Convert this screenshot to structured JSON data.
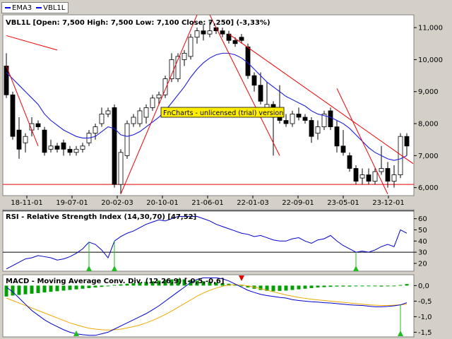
{
  "legend": [
    {
      "label": "EMA3",
      "color": "#0000ff"
    },
    {
      "label": "VBL1L",
      "color": "#0000ff"
    }
  ],
  "watermark": "FnCharts - unlicensed (trial) version",
  "colors": {
    "ema": "#1c1cdc",
    "trendline": "#ee0000",
    "rsi": "#0000cc",
    "macd": "#0000cc",
    "signal": "#f0a800",
    "hist": "#00a000",
    "arrow_up": "#22bb22",
    "arrow_down": "#dd0000",
    "watermark_bg": "#ffee00"
  },
  "chart_data": [
    {
      "type": "candlestick",
      "title": "VBL1L [Open: 7,500  High: 7,500  Low: 7,100  Close: 7,250] (-3,33%)",
      "ylim": [
        5.75,
        11.4
      ],
      "yticks": [
        6.0,
        7.0,
        8.0,
        9.0,
        10.0,
        11.0
      ],
      "ytick_labels": [
        "6,000",
        "7,000",
        "8,000",
        "9,000",
        "10,000",
        "11,000"
      ],
      "xtick_labels": [
        "18-11-01",
        "19-07-01",
        "20-02-03",
        "20-10-01",
        "21-06-01",
        "22-01-03",
        "22-09-01",
        "23-05-01",
        "23-12-01"
      ],
      "support_level": 6.1,
      "candles": [
        {
          "o": 9.8,
          "h": 10.2,
          "l": 8.8,
          "c": 8.9
        },
        {
          "o": 8.9,
          "h": 9.0,
          "l": 7.5,
          "c": 7.6
        },
        {
          "o": 7.8,
          "h": 8.2,
          "l": 6.9,
          "c": 7.2
        },
        {
          "o": 7.4,
          "h": 7.7,
          "l": 7.1,
          "c": 7.6
        },
        {
          "o": 7.8,
          "h": 8.2,
          "l": 7.6,
          "c": 8.0
        },
        {
          "o": 8.0,
          "h": 8.1,
          "l": 7.8,
          "c": 7.9
        },
        {
          "o": 7.8,
          "h": 7.9,
          "l": 7.0,
          "c": 7.1
        },
        {
          "o": 7.2,
          "h": 7.5,
          "l": 7.1,
          "c": 7.3
        },
        {
          "o": 7.3,
          "h": 7.4,
          "l": 7.1,
          "c": 7.2
        },
        {
          "o": 7.4,
          "h": 7.5,
          "l": 7.0,
          "c": 7.2
        },
        {
          "o": 7.2,
          "h": 7.3,
          "l": 7.0,
          "c": 7.1
        },
        {
          "o": 7.1,
          "h": 7.3,
          "l": 7.0,
          "c": 7.2
        },
        {
          "o": 7.2,
          "h": 7.4,
          "l": 7.1,
          "c": 7.3
        },
        {
          "o": 7.4,
          "h": 7.8,
          "l": 7.3,
          "c": 7.7
        },
        {
          "o": 7.7,
          "h": 8.0,
          "l": 7.5,
          "c": 7.9
        },
        {
          "o": 8.0,
          "h": 8.5,
          "l": 7.9,
          "c": 8.3
        },
        {
          "o": 8.3,
          "h": 8.5,
          "l": 8.2,
          "c": 8.4
        },
        {
          "o": 8.5,
          "h": 8.6,
          "l": 6.0,
          "c": 6.1
        },
        {
          "o": 6.1,
          "h": 7.2,
          "l": 5.8,
          "c": 7.1
        },
        {
          "o": 7.0,
          "h": 8.1,
          "l": 6.9,
          "c": 8.0
        },
        {
          "o": 8.0,
          "h": 8.3,
          "l": 7.9,
          "c": 8.2
        },
        {
          "o": 8.0,
          "h": 8.5,
          "l": 7.9,
          "c": 8.4
        },
        {
          "o": 8.2,
          "h": 8.6,
          "l": 8.0,
          "c": 8.5
        },
        {
          "o": 8.5,
          "h": 8.9,
          "l": 8.4,
          "c": 8.8
        },
        {
          "o": 8.8,
          "h": 9.0,
          "l": 8.6,
          "c": 8.9
        },
        {
          "o": 8.9,
          "h": 9.5,
          "l": 8.8,
          "c": 9.4
        },
        {
          "o": 9.4,
          "h": 10.2,
          "l": 9.3,
          "c": 10.0
        },
        {
          "o": 9.4,
          "h": 10.2,
          "l": 9.3,
          "c": 10.1
        },
        {
          "o": 10.0,
          "h": 10.3,
          "l": 9.8,
          "c": 10.2
        },
        {
          "o": 10.1,
          "h": 10.8,
          "l": 10.0,
          "c": 10.7
        },
        {
          "o": 10.7,
          "h": 11.0,
          "l": 10.5,
          "c": 10.9
        },
        {
          "o": 10.9,
          "h": 11.1,
          "l": 10.6,
          "c": 10.8
        },
        {
          "o": 10.8,
          "h": 11.2,
          "l": 10.7,
          "c": 10.9
        },
        {
          "o": 11.0,
          "h": 11.0,
          "l": 10.8,
          "c": 10.9
        },
        {
          "o": 10.9,
          "h": 11.0,
          "l": 10.7,
          "c": 10.8
        },
        {
          "o": 10.8,
          "h": 10.9,
          "l": 10.5,
          "c": 10.6
        },
        {
          "o": 10.6,
          "h": 10.7,
          "l": 10.4,
          "c": 10.5
        },
        {
          "o": 10.7,
          "h": 10.8,
          "l": 10.5,
          "c": 10.6
        },
        {
          "o": 10.4,
          "h": 10.5,
          "l": 9.4,
          "c": 9.5
        },
        {
          "o": 9.5,
          "h": 9.6,
          "l": 9.0,
          "c": 9.2
        },
        {
          "o": 9.2,
          "h": 9.6,
          "l": 8.6,
          "c": 8.7
        },
        {
          "o": 8.5,
          "h": 9.3,
          "l": 8.3,
          "c": 8.6
        },
        {
          "o": 8.6,
          "h": 8.7,
          "l": 7.0,
          "c": 8.2
        },
        {
          "o": 8.3,
          "h": 9.2,
          "l": 8.0,
          "c": 8.1
        },
        {
          "o": 8.1,
          "h": 8.3,
          "l": 7.9,
          "c": 8.0
        },
        {
          "o": 8.0,
          "h": 8.4,
          "l": 7.9,
          "c": 8.3
        },
        {
          "o": 8.3,
          "h": 8.5,
          "l": 8.1,
          "c": 8.2
        },
        {
          "o": 8.2,
          "h": 8.3,
          "l": 8.0,
          "c": 8.1
        },
        {
          "o": 8.1,
          "h": 8.2,
          "l": 7.4,
          "c": 7.6
        },
        {
          "o": 7.7,
          "h": 8.1,
          "l": 7.5,
          "c": 7.9
        },
        {
          "o": 7.9,
          "h": 8.4,
          "l": 7.8,
          "c": 8.3
        },
        {
          "o": 8.4,
          "h": 8.5,
          "l": 7.8,
          "c": 7.9
        },
        {
          "o": 7.9,
          "h": 8.1,
          "l": 7.1,
          "c": 7.3
        },
        {
          "o": 7.3,
          "h": 7.8,
          "l": 7.0,
          "c": 7.1
        },
        {
          "o": 7.0,
          "h": 7.1,
          "l": 6.5,
          "c": 6.6
        },
        {
          "o": 6.6,
          "h": 6.7,
          "l": 6.1,
          "c": 6.2
        },
        {
          "o": 6.3,
          "h": 6.6,
          "l": 6.1,
          "c": 6.4
        },
        {
          "o": 6.4,
          "h": 6.6,
          "l": 6.1,
          "c": 6.2
        },
        {
          "o": 6.2,
          "h": 6.6,
          "l": 6.1,
          "c": 6.5
        },
        {
          "o": 6.5,
          "h": 7.3,
          "l": 6.4,
          "c": 6.6
        },
        {
          "o": 6.6,
          "h": 6.8,
          "l": 6.0,
          "c": 6.2
        },
        {
          "o": 6.2,
          "h": 6.7,
          "l": 6.0,
          "c": 6.4
        },
        {
          "o": 6.4,
          "h": 7.7,
          "l": 6.3,
          "c": 7.6
        },
        {
          "o": 7.6,
          "h": 7.7,
          "l": 7.0,
          "c": 7.3
        }
      ],
      "ema": [
        9.6,
        9.4,
        9.2,
        9.0,
        8.8,
        8.6,
        8.3,
        8.1,
        7.95,
        7.8,
        7.7,
        7.6,
        7.55,
        7.55,
        7.6,
        7.75,
        7.9,
        7.85,
        7.65,
        7.6,
        7.65,
        7.75,
        7.9,
        8.05,
        8.2,
        8.4,
        8.65,
        8.9,
        9.15,
        9.45,
        9.7,
        9.9,
        10.05,
        10.15,
        10.2,
        10.2,
        10.15,
        10.05,
        9.9,
        9.7,
        9.5,
        9.3,
        9.15,
        9.0,
        8.85,
        8.75,
        8.65,
        8.55,
        8.4,
        8.3,
        8.25,
        8.2,
        8.1,
        8.0,
        7.85,
        7.65,
        7.45,
        7.25,
        7.1,
        7.0,
        6.9,
        6.85,
        6.9,
        7.0
      ],
      "trendlines": [
        {
          "x1": 0,
          "y1": 9.8,
          "x2": 5,
          "y2": 7.3
        },
        {
          "x1": 0,
          "y1": 10.75,
          "x2": 8,
          "y2": 10.3
        },
        {
          "x1": 18,
          "y1": 5.8,
          "x2": 30,
          "y2": 11.4
        },
        {
          "x1": 32,
          "y1": 11.4,
          "x2": 43,
          "y2": 7.0
        },
        {
          "x1": 35,
          "y1": 10.8,
          "x2": 64,
          "y2": 6.75
        },
        {
          "x1": 52,
          "y1": 9.1,
          "x2": 60,
          "y2": 5.8
        }
      ]
    },
    {
      "type": "line",
      "title": "RSI - Relative Strength Index (14,30,70) [47,52]",
      "ylim": [
        13,
        68
      ],
      "yticks": [
        20,
        30,
        40,
        50,
        60
      ],
      "ytick_labels": [
        "20",
        "30",
        "40",
        "50",
        "60"
      ],
      "level": 30,
      "values": [
        15,
        18,
        21,
        24,
        25,
        27,
        26,
        25,
        23,
        24,
        26,
        29,
        33,
        39,
        37,
        32,
        25,
        40,
        44,
        47,
        49,
        52,
        55,
        57,
        59,
        58,
        60,
        62,
        62,
        62,
        62,
        60,
        58,
        55,
        53,
        51,
        49,
        47,
        46,
        44,
        45,
        43,
        41,
        40,
        40,
        42,
        43,
        40,
        38,
        41,
        42,
        45,
        40,
        36,
        33,
        30,
        31,
        30,
        32,
        35,
        37,
        35,
        50,
        47
      ],
      "signals": [
        {
          "x": 13,
          "dir": "up"
        },
        {
          "x": 17,
          "dir": "up"
        },
        {
          "x": 55,
          "dir": "up"
        }
      ]
    },
    {
      "type": "line",
      "title": "MACD - Moving Average Conv. Div. (12,26,9) [-0,5,-0,6]",
      "ylim": [
        -1.65,
        0.35
      ],
      "yticks": [
        0.0,
        -0.5,
        -1.0,
        -1.5
      ],
      "ytick_labels": [
        "0,0",
        "-0,5",
        "-1,0",
        "-1,5"
      ],
      "series": [
        {
          "name": "MACD",
          "values": [
            -0.05,
            -0.2,
            -0.4,
            -0.6,
            -0.8,
            -0.95,
            -1.1,
            -1.22,
            -1.32,
            -1.42,
            -1.5,
            -1.55,
            -1.58,
            -1.6,
            -1.6,
            -1.55,
            -1.5,
            -1.4,
            -1.3,
            -1.2,
            -1.1,
            -1.0,
            -0.9,
            -0.78,
            -0.65,
            -0.5,
            -0.35,
            -0.2,
            -0.05,
            0.1,
            0.2,
            0.25,
            0.25,
            0.25,
            0.22,
            0.15,
            0.05,
            -0.05,
            -0.15,
            -0.22,
            -0.28,
            -0.32,
            -0.35,
            -0.38,
            -0.4,
            -0.45,
            -0.48,
            -0.5,
            -0.52,
            -0.53,
            -0.55,
            -0.56,
            -0.58,
            -0.6,
            -0.62,
            -0.63,
            -0.64,
            -0.66,
            -0.68,
            -0.68,
            -0.67,
            -0.65,
            -0.62,
            -0.55
          ]
        },
        {
          "name": "Signal",
          "values": [
            -0.4,
            -0.48,
            -0.56,
            -0.64,
            -0.72,
            -0.8,
            -0.88,
            -0.96,
            -1.04,
            -1.12,
            -1.2,
            -1.26,
            -1.32,
            -1.37,
            -1.4,
            -1.42,
            -1.43,
            -1.42,
            -1.4,
            -1.36,
            -1.32,
            -1.27,
            -1.2,
            -1.12,
            -1.03,
            -0.93,
            -0.82,
            -0.7,
            -0.58,
            -0.46,
            -0.34,
            -0.24,
            -0.15,
            -0.08,
            -0.02,
            0.02,
            0.03,
            0.02,
            -0.01,
            -0.05,
            -0.1,
            -0.15,
            -0.2,
            -0.25,
            -0.3,
            -0.34,
            -0.38,
            -0.41,
            -0.44,
            -0.46,
            -0.48,
            -0.5,
            -0.52,
            -0.54,
            -0.56,
            -0.58,
            -0.6,
            -0.62,
            -0.63,
            -0.64,
            -0.64,
            -0.63,
            -0.62,
            -0.6
          ]
        }
      ],
      "histogram": [
        -0.35,
        -0.32,
        -0.3,
        -0.28,
        -0.26,
        -0.24,
        -0.22,
        -0.2,
        -0.18,
        -0.16,
        -0.14,
        -0.12,
        -0.1,
        -0.08,
        -0.06,
        -0.04,
        -0.02,
        0.02,
        0.04,
        0.06,
        0.08,
        0.1,
        0.12,
        0.14,
        0.16,
        0.18,
        0.2,
        0.22,
        0.2,
        0.18,
        0.16,
        0.14,
        0.12,
        0.1,
        0.08,
        0.06,
        0.04,
        -0.02,
        -0.06,
        -0.1,
        -0.14,
        -0.17,
        -0.18,
        -0.17,
        -0.16,
        -0.14,
        -0.12,
        -0.1,
        -0.08,
        -0.06,
        -0.05,
        -0.04,
        -0.03,
        -0.03,
        -0.03,
        -0.02,
        -0.02,
        -0.02,
        -0.02,
        -0.03,
        -0.02,
        -0.01,
        0.02,
        0.05
      ],
      "signals": [
        {
          "x": 11,
          "dir": "up"
        },
        {
          "x": 37,
          "dir": "down"
        },
        {
          "x": 62,
          "dir": "up"
        }
      ]
    }
  ]
}
